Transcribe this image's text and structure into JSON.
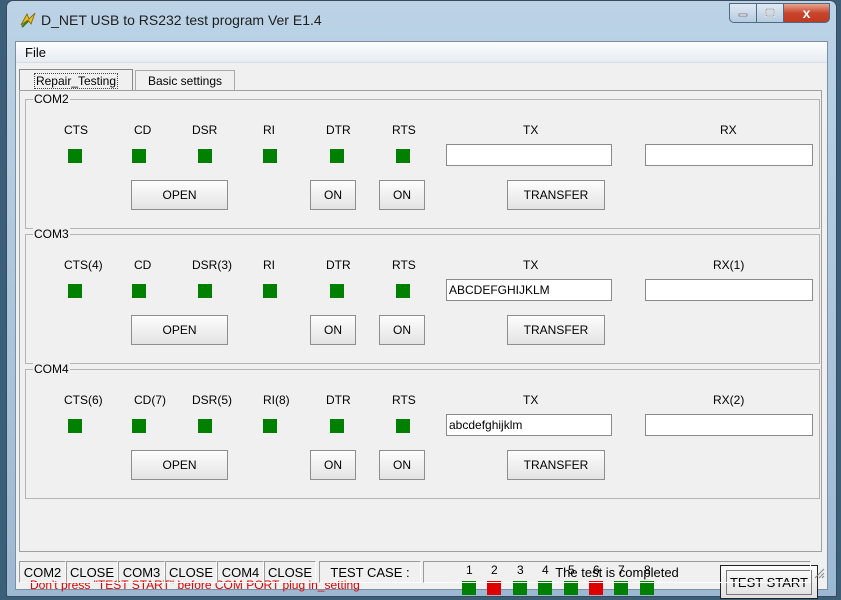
{
  "window": {
    "title": "D_NET USB to RS232 test program Ver E1.4",
    "min_label": "",
    "max_label": "",
    "close_label": "x"
  },
  "menu": {
    "file": "File"
  },
  "tabs": {
    "repair": "Repair_Testing",
    "basic": "Basic settings"
  },
  "groups": [
    {
      "title": "COM2",
      "labels": [
        "CTS",
        "CD",
        "DSR",
        "RI",
        "DTR",
        "RTS"
      ],
      "tx_label": "TX",
      "rx_label": "RX",
      "tx_value": "",
      "rx_value": "",
      "open_label": "OPEN",
      "dtr_btn": "ON",
      "rts_btn": "ON",
      "transfer_label": "TRANSFER",
      "leds": [
        "green",
        "green",
        "green",
        "green",
        "green",
        "green"
      ]
    },
    {
      "title": "COM3",
      "labels": [
        "CTS(4)",
        "CD",
        "DSR(3)",
        "RI",
        "DTR",
        "RTS"
      ],
      "tx_label": "TX",
      "rx_label": "RX(1)",
      "tx_value": "ABCDEFGHIJKLM",
      "rx_value": "",
      "open_label": "OPEN",
      "dtr_btn": "ON",
      "rts_btn": "ON",
      "transfer_label": "TRANSFER",
      "leds": [
        "green",
        "green",
        "green",
        "green",
        "green",
        "green"
      ]
    },
    {
      "title": "COM4",
      "labels": [
        "CTS(6)",
        "CD(7)",
        "DSR(5)",
        "RI(8)",
        "DTR",
        "RTS"
      ],
      "tx_label": "TX",
      "rx_label": "RX(2)",
      "tx_value": "abcdefghijklm",
      "rx_value": "",
      "open_label": "OPEN",
      "dtr_btn": "ON",
      "rts_btn": "ON",
      "transfer_label": "TRANSFER",
      "leds": [
        "green",
        "green",
        "green",
        "green",
        "green",
        "green"
      ]
    }
  ],
  "bottom": {
    "warning": "Don't press \"TEST START\" before COM PORT plug in_setting",
    "led_numbers": [
      "1",
      "2",
      "3",
      "4",
      "5",
      "6",
      "7",
      "8"
    ],
    "led_states": [
      "green",
      "red",
      "green",
      "green",
      "green",
      "red",
      "green",
      "green"
    ],
    "start_label": "TEST START"
  },
  "status": {
    "com2": "COM2",
    "com2_state": "CLOSE",
    "com3": "COM3",
    "com3_state": "CLOSE",
    "com4": "COM4",
    "com4_state": "CLOSE",
    "test_case_label": "TEST CASE :",
    "message": "The test is completed"
  },
  "colors": {
    "led_green": "#008000",
    "led_red": "#e00000",
    "warning_text": "#e00000"
  }
}
